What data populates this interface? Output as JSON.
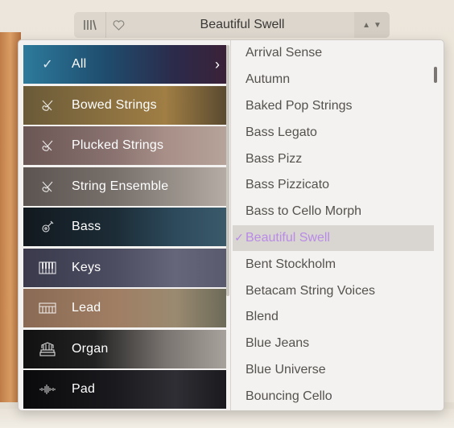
{
  "header": {
    "library_icon": "library-icon",
    "heart_icon": "heart-icon",
    "preset_name": "Beautiful Swell",
    "prev_arrow": "▲",
    "next_arrow": "▼"
  },
  "categories": [
    {
      "label": "All",
      "icon": "check-icon",
      "selected": true,
      "has_chevron": true
    },
    {
      "label": "Bowed Strings",
      "icon": "violin-icon"
    },
    {
      "label": "Plucked Strings",
      "icon": "violin-icon"
    },
    {
      "label": "String Ensemble",
      "icon": "violin-icon"
    },
    {
      "label": "Bass",
      "icon": "guitar-icon"
    },
    {
      "label": "Keys",
      "icon": "piano-keys-icon"
    },
    {
      "label": "Lead",
      "icon": "keyboard-icon"
    },
    {
      "label": "Organ",
      "icon": "organ-icon"
    },
    {
      "label": "Pad",
      "icon": "waveform-icon"
    }
  ],
  "presets": [
    {
      "label": "Arrival Sense"
    },
    {
      "label": "Autumn"
    },
    {
      "label": "Baked Pop Strings"
    },
    {
      "label": "Bass Legato"
    },
    {
      "label": "Bass Pizz"
    },
    {
      "label": "Bass Pizzicato"
    },
    {
      "label": "Bass to Cello Morph"
    },
    {
      "label": "Beautiful Swell",
      "selected": true
    },
    {
      "label": "Bent Stockholm"
    },
    {
      "label": "Betacam String Voices"
    },
    {
      "label": "Blend"
    },
    {
      "label": "Blue Jeans"
    },
    {
      "label": "Blue Universe"
    },
    {
      "label": "Bouncing Cello"
    }
  ],
  "colors": {
    "selected_preset_text": "#b98ae6",
    "selected_preset_bg": "#d9d6d2"
  }
}
